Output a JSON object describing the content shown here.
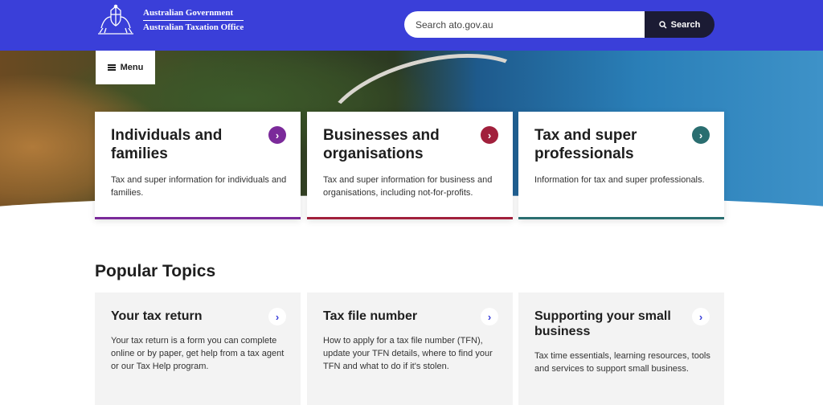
{
  "header": {
    "brand_line1": "Australian Government",
    "brand_line2": "Australian Taxation Office",
    "search_placeholder": "Search ato.gov.au",
    "search_button": "Search",
    "color": "#3a3fd9"
  },
  "nav": {
    "menu_label": "Menu"
  },
  "categories": [
    {
      "title": "Individuals and families",
      "description": "Tax and super information for individuals and families.",
      "color": "#7b2a9a",
      "icon": "chevron-right-icon"
    },
    {
      "title": "Businesses and organisations",
      "description": "Tax and super information for business and organisations, including not-for-profits.",
      "color": "#a1203c",
      "icon": "chevron-right-icon"
    },
    {
      "title": "Tax and super professionals",
      "description": "Information for tax and super professionals.",
      "color": "#2a6e70",
      "icon": "chevron-right-icon"
    }
  ],
  "popular": {
    "heading": "Popular Topics",
    "topics": [
      {
        "title": "Your tax return",
        "description": "Your tax return is a form you can complete online or by paper, get help from a tax agent or our Tax Help program."
      },
      {
        "title": "Tax file number",
        "description": "How to apply for a tax file number (TFN), update your TFN details, where to find your TFN and what to do if it's stolen."
      },
      {
        "title": "Supporting your small business",
        "description": "Tax time essentials, learning resources, tools and services to support small business."
      }
    ]
  }
}
